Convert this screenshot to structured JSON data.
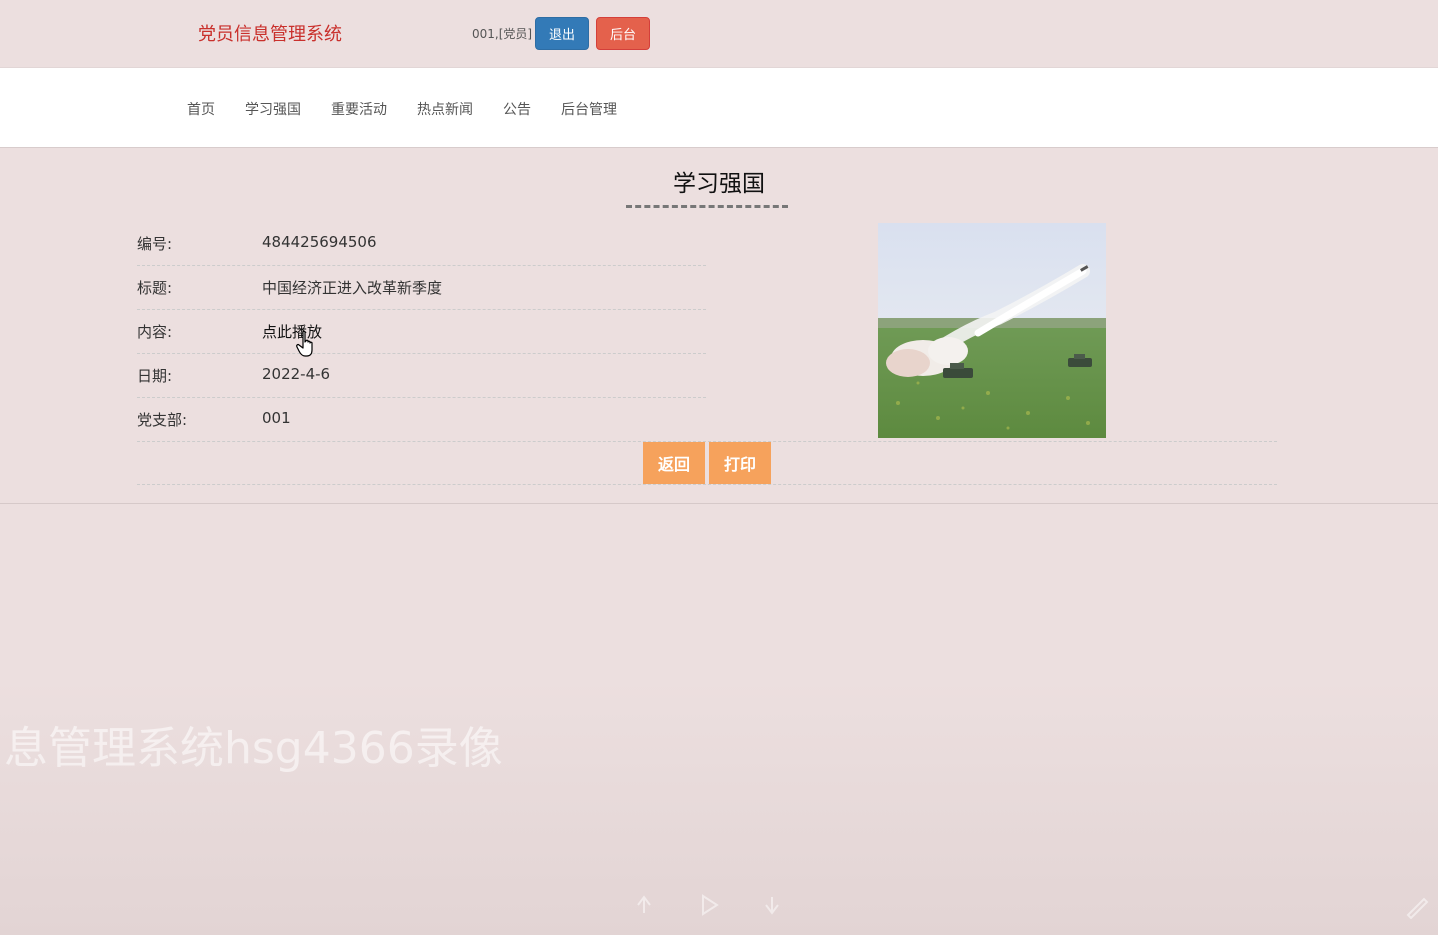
{
  "header": {
    "site_title": "党员信息管理系统",
    "user_info": "001,[党员]",
    "logout_label": "退出",
    "admin_label": "后台"
  },
  "nav": {
    "items": [
      {
        "label": "首页"
      },
      {
        "label": "学习强国"
      },
      {
        "label": "重要活动"
      },
      {
        "label": "热点新闻"
      },
      {
        "label": "公告"
      },
      {
        "label": "后台管理"
      }
    ]
  },
  "detail": {
    "section_title": "学习强国",
    "fields": [
      {
        "label": "编号:",
        "value": "484425694506"
      },
      {
        "label": "标题:",
        "value": "中国经济正进入改革新季度"
      },
      {
        "label": "内容:",
        "value": "点此播放"
      },
      {
        "label": "日期:",
        "value": "2022-4-6"
      },
      {
        "label": "党支部:",
        "value": "001"
      }
    ],
    "back_label": "返回",
    "print_label": "打印"
  },
  "overlay": {
    "watermark": "息管理系统hsg4366录像"
  },
  "colors": {
    "page_bg": "#ecdfdf",
    "title_red": "#c9302c",
    "logout_blue": "#337ab7",
    "admin_red": "#e4614c",
    "action_orange": "#f6a25c"
  },
  "icons": {
    "cursor": "hand-pointer-icon",
    "watermark_controls": [
      "undo-icon",
      "play-icon",
      "redo-icon",
      "pen-icon"
    ]
  }
}
